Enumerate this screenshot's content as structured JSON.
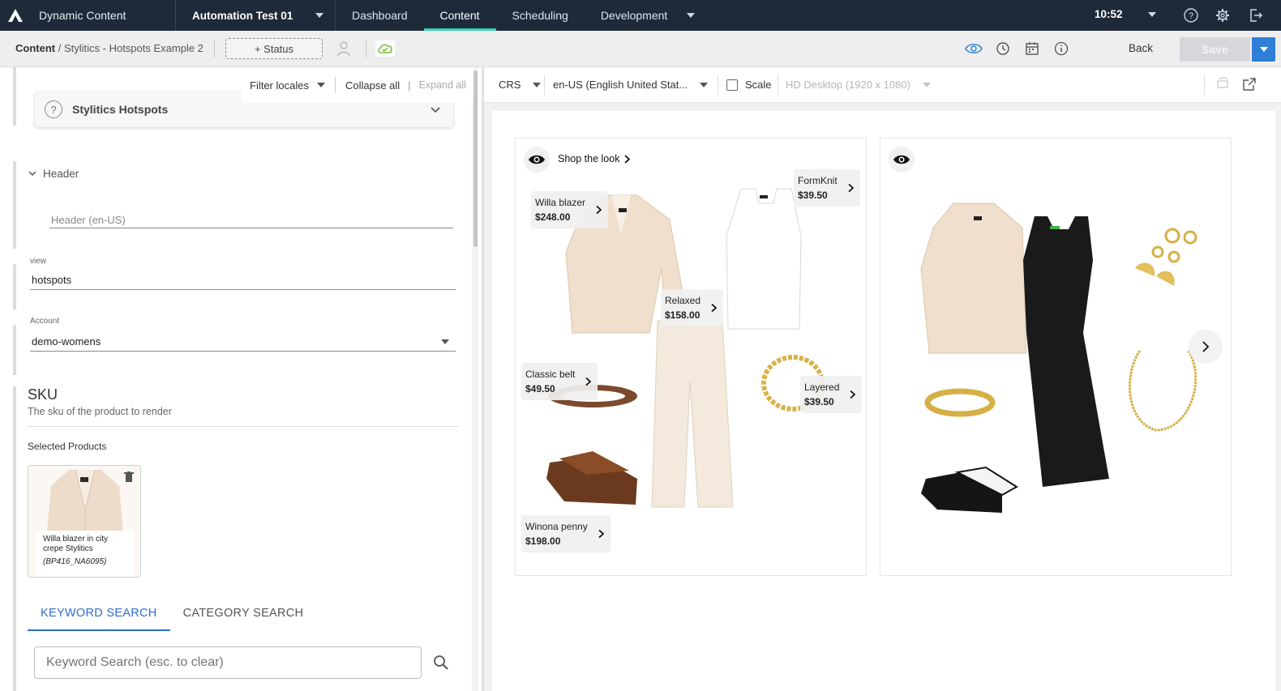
{
  "topnav": {
    "app_title": "Dynamic Content",
    "hub": "Automation Test 01",
    "items": [
      "Dashboard",
      "Content",
      "Scheduling",
      "Development"
    ],
    "active": "Content",
    "time": "10:52"
  },
  "subbar": {
    "breadcrumb_root": "Content",
    "breadcrumb_item": "/ Stylitics - Hotspots Example 2",
    "status_label": "+ Status",
    "back_label": "Back",
    "save_label": "Save"
  },
  "editor": {
    "filter_locales": "Filter locales",
    "collapse_all": "Collapse all",
    "pipe": "|",
    "expand_all": "Expand all",
    "schema_title": "Stylitics Hotspots",
    "header_section": "Header",
    "header_placeholder": "Header (en-US)",
    "view_label": "view",
    "view_value": "hotspots",
    "account_label": "Account",
    "account_value": "demo-womens",
    "sku_title": "SKU",
    "sku_description": "The sku of the product to render",
    "selected_products_label": "Selected Products",
    "product": {
      "name": "Willa blazer in city crepe Stylitics",
      "sku": "(BP416_NA6095)"
    },
    "tabs": [
      "KEYWORD SEARCH",
      "CATEGORY SEARCH"
    ],
    "keyword_placeholder": "Keyword Search (esc. to clear)"
  },
  "preview_toolbar": {
    "crs": "CRS",
    "locale": "en-US (English United Stat...",
    "scale": "Scale",
    "device": "HD Desktop (1920 x 1080)"
  },
  "preview": {
    "shop_the_look": "Shop the look",
    "hotspots": [
      {
        "name": "Willa blazer",
        "price": "$248.00"
      },
      {
        "name": "FormKnit",
        "price": "$39.50"
      },
      {
        "name": "Relaxed",
        "price": "$158.00"
      },
      {
        "name": "Classic belt",
        "price": "$49.50"
      },
      {
        "name": "Layered",
        "price": "$39.50"
      },
      {
        "name": "Winona penny",
        "price": "$198.00"
      }
    ]
  },
  "colors": {
    "nav_bg": "#1e2a3a",
    "active_accent": "#3dd0b0",
    "primary_blue": "#2f7fd6",
    "cloud_green": "#7cc142"
  }
}
